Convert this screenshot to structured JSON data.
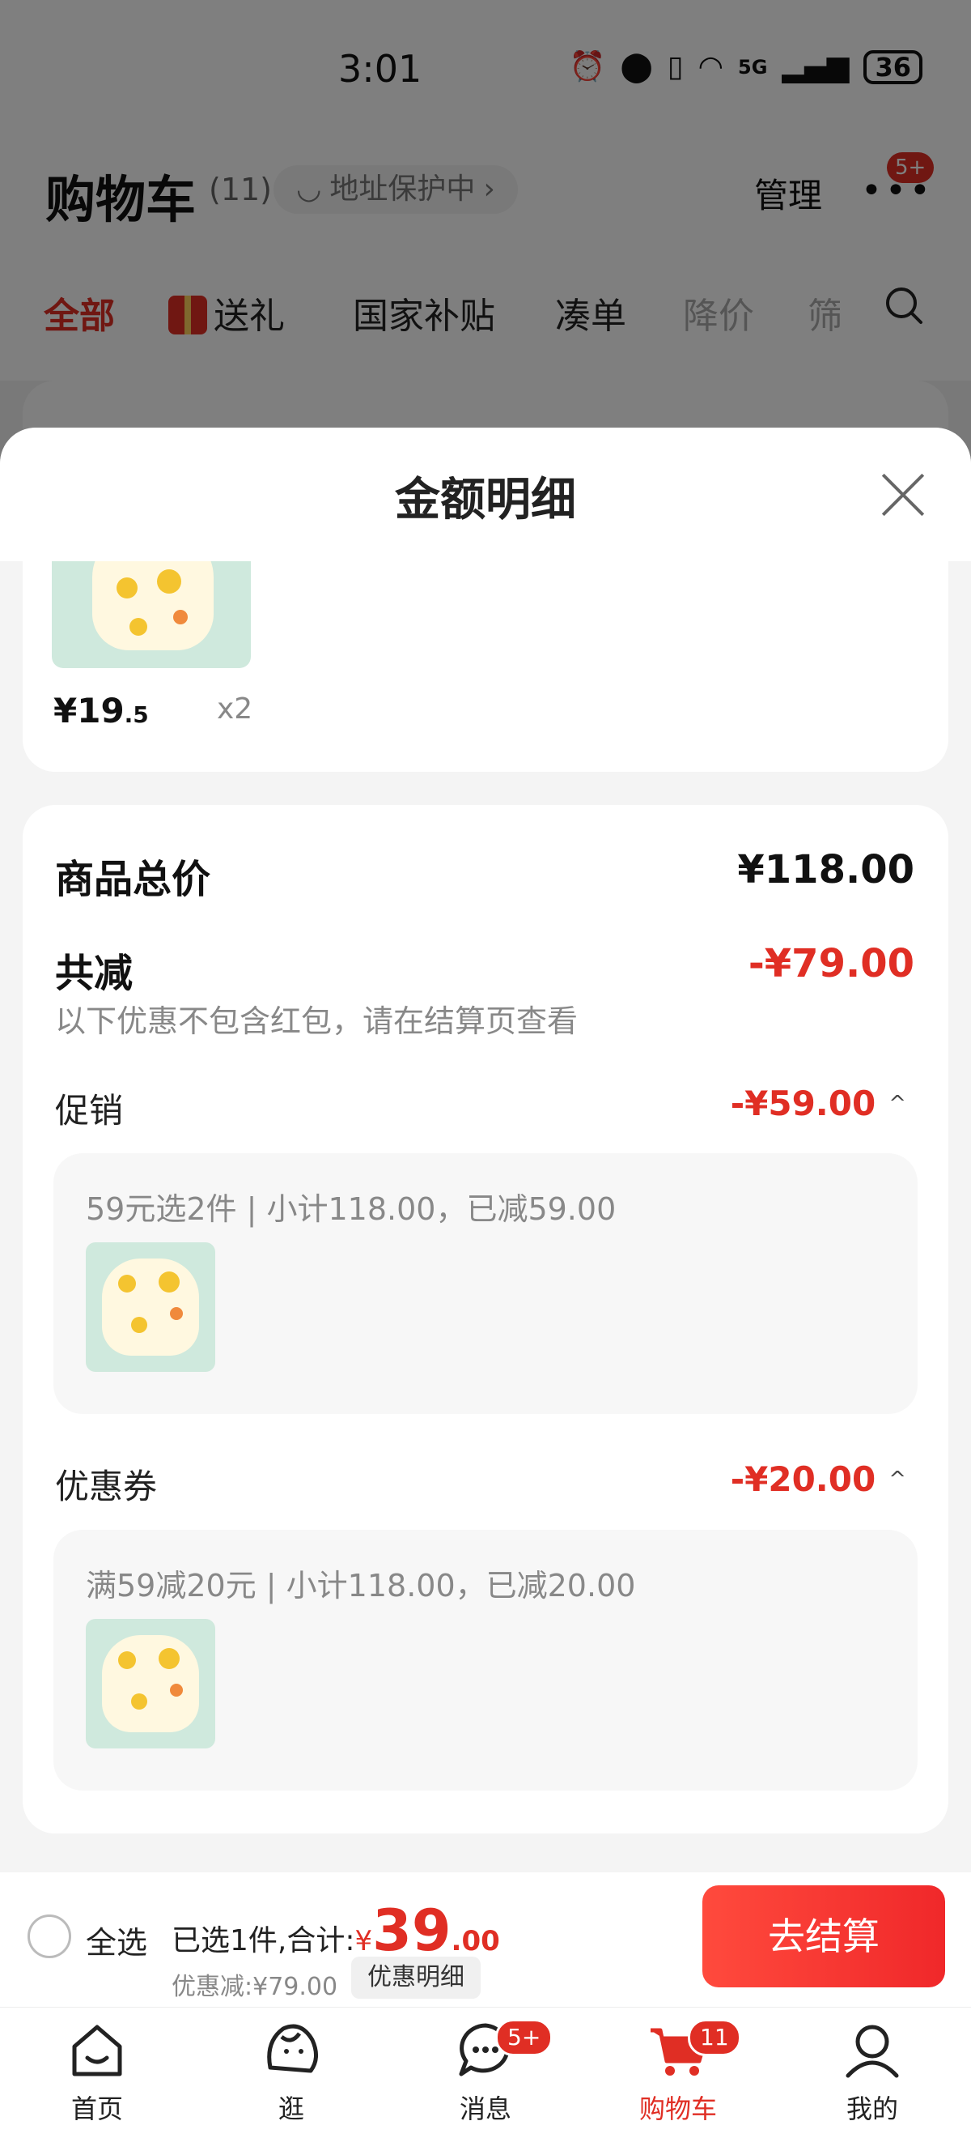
{
  "status_bar": {
    "time": "3:01",
    "network": "5G",
    "battery": "36"
  },
  "header": {
    "title": "购物车",
    "count": "(11)",
    "address_protect": "地址保护中",
    "manage": "管理",
    "more_badge": "5+"
  },
  "filters": [
    {
      "label": "全部"
    },
    {
      "label": "送礼"
    },
    {
      "label": "国家补贴"
    },
    {
      "label": "凑单"
    },
    {
      "label": "降价"
    },
    {
      "label": "筛"
    }
  ],
  "sheet": {
    "title": "金额明细",
    "item": {
      "price_main": "¥19",
      "price_dec": ".5",
      "qty": "x2"
    },
    "total": {
      "label": "商品总价",
      "value": "¥118.00"
    },
    "reduction": {
      "label": "共减",
      "value": "-¥79.00",
      "hint": "以下优惠不包含红包，请在结算页查看"
    },
    "promotion": {
      "label": "促销",
      "value": "-¥59.00",
      "desc": "59元选2件 | 小计118.00，已减59.00"
    },
    "coupon": {
      "label": "优惠券",
      "value": "-¥20.00",
      "desc": "满59减20元 | 小计118.00，已减20.00"
    }
  },
  "checkout": {
    "select_all": "全选",
    "selected_text": "已选1件,合计:",
    "currency": "¥",
    "total_int": "39",
    "total_dec": ".00",
    "discount": "优惠减:¥79.00",
    "detail_chip": "优惠明细",
    "button": "去结算"
  },
  "tabs": [
    {
      "label": "首页"
    },
    {
      "label": "逛"
    },
    {
      "label": "消息",
      "badge": "5+"
    },
    {
      "label": "购物车",
      "badge": "11"
    },
    {
      "label": "我的"
    }
  ],
  "colors": {
    "accent": "#e02e24",
    "overlay": "rgba(0,0,0,0.5)"
  }
}
